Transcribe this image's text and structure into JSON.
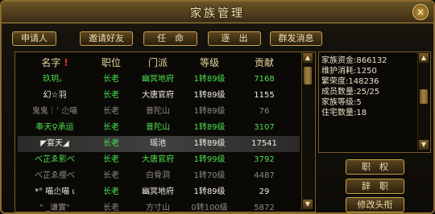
{
  "window": {
    "title": "家族管理",
    "close": "×"
  },
  "buttons": {
    "apply": "申请人",
    "invite": "邀请好友",
    "appoint": "任　命",
    "expel": "逐　出",
    "announce": "群发消息",
    "rank": "职　权",
    "resign": "辞　职",
    "rename": "修改头衔"
  },
  "table": {
    "headers": [
      "名字",
      "职位",
      "门派",
      "等级",
      "贡献"
    ],
    "rows": [
      {
        "name": "玖玥。",
        "pos": "长老",
        "sect": "幽冥地府",
        "level": "1转89级",
        "contrib": "7168",
        "color": "#4fe04f"
      },
      {
        "name": "幻☆羽",
        "pos": "长老",
        "sect": "大唐官府",
        "level": "1转89级",
        "contrib": "1155",
        "color": "#f0ede0"
      },
      {
        "name": "鬼鬼｜ʼ 尐喵",
        "pos": "长老",
        "sect": "普陀山",
        "level": "1转89级",
        "contrib": "76",
        "color": "#8e8a80"
      },
      {
        "name": "奉天♀承运",
        "pos": "长老",
        "sect": "普陀山",
        "level": "1转89级",
        "contrib": "3107",
        "color": "#4fe04f"
      },
      {
        "name": "◤宴天◢",
        "pos": "长老",
        "sect": "瑶池",
        "level": "1转89级",
        "contrib": "17541",
        "color": "#f0ede0"
      },
      {
        "name": "べ芷ゑ影べ",
        "pos": "长老",
        "sect": "大唐官府",
        "level": "1转99级",
        "contrib": "3792",
        "color": "#4fe04f"
      },
      {
        "name": "べ芷ゑ缨べ",
        "pos": "长老",
        "sect": "白骨洞",
        "level": "1转70级",
        "contrib": "4487",
        "color": "#8e8a80"
      },
      {
        "name": "*° 喵尐喵 ι",
        "pos": "长老",
        "sect": "幽冥地府",
        "level": "1转89级",
        "contrib": "29",
        "color": "#f0ede0"
      },
      {
        "name": "\" _谦實\"",
        "pos": "长老",
        "sect": "方寸山",
        "level": "0转100级",
        "contrib": "5872",
        "color": "#8e8a80"
      }
    ]
  },
  "family_info": [
    {
      "label": "家族资金",
      "value": "866132"
    },
    {
      "label": "维护消耗",
      "value": "1250"
    },
    {
      "label": "繁荣度",
      "value": "148236"
    },
    {
      "label": "成员数量",
      "value": "25/25"
    },
    {
      "label": "家族等级",
      "value": "5"
    },
    {
      "label": "住宅数量",
      "value": "18"
    }
  ],
  "colors": {
    "accent": "#c7a14e",
    "green": "#4fe04f",
    "gray": "#8e8a80",
    "white": "#f0ede0",
    "header_mark": "#e03a2a"
  },
  "icons": {
    "close": "close-icon",
    "scroll_up": "arrow-up-icon",
    "scroll_down": "arrow-down-icon",
    "sort": "sort-marker-icon"
  }
}
